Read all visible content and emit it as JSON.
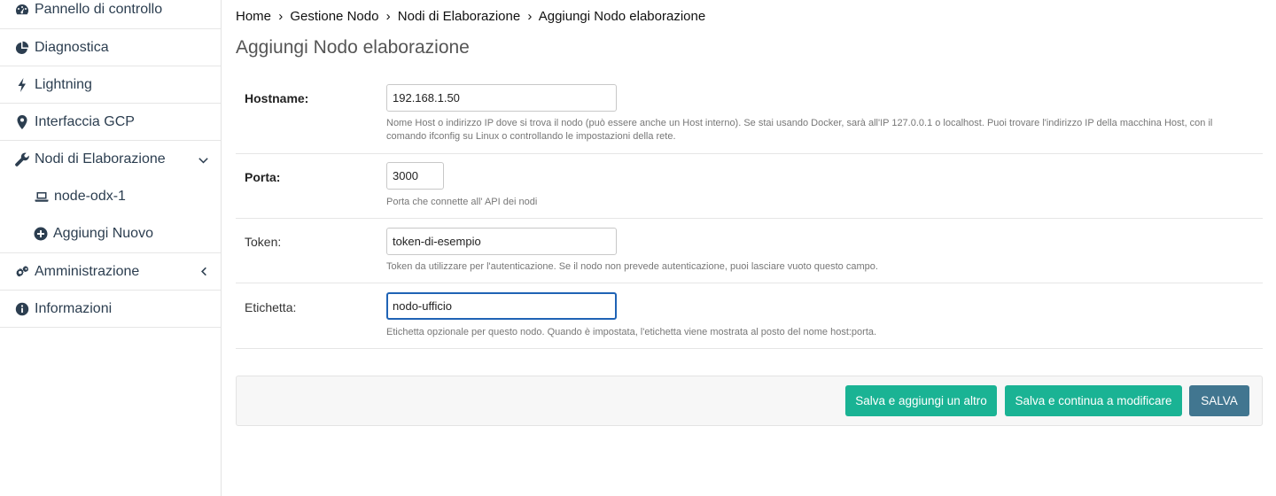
{
  "sidebar": {
    "items": [
      {
        "label": "Pannello di controllo",
        "icon": "dashboard-icon"
      },
      {
        "label": "Diagnostica",
        "icon": "pie-chart-icon"
      },
      {
        "label": "Lightning",
        "icon": "bolt-icon"
      },
      {
        "label": "Interfaccia GCP",
        "icon": "map-marker-icon"
      },
      {
        "label": "Nodi di Elaborazione",
        "icon": "wrench-icon",
        "expanded": true
      },
      {
        "label": "Amministrazione",
        "icon": "gears-icon",
        "expanded": false
      },
      {
        "label": "Informazioni",
        "icon": "info-circle-icon"
      }
    ],
    "subitems": [
      {
        "label": "node-odx-1",
        "icon": "laptop-icon"
      },
      {
        "label": "Aggiungi Nuovo",
        "icon": "plus-circle-icon"
      }
    ]
  },
  "breadcrumb": {
    "home": "Home",
    "sep": "›",
    "level1": "Gestione Nodo",
    "level2": "Nodi di Elaborazione",
    "current": "Aggiungi Nodo elaborazione"
  },
  "page_title": "Aggiungi Nodo elaborazione",
  "form": {
    "hostname": {
      "label": "Hostname:",
      "value": "192.168.1.50",
      "help_line1": "Nome Host o indirizzo IP dove si trova il nodo (può essere anche un Host interno). Se stai usando Docker, sarà all'IP 127.0.0.1 o localhost. Puoi trovare l'indirizzo IP della macchina Host, con il",
      "help_line2": "comando ifconfig su Linux o controllando le impostazioni della rete."
    },
    "port": {
      "label": "Porta:",
      "value": "3000",
      "help": "Porta che connette all' API dei nodi"
    },
    "token": {
      "label": "Token:",
      "value": "token-di-esempio",
      "help": "Token da utilizzare per l'autenticazione. Se il nodo non prevede autenticazione, puoi lasciare vuoto questo campo."
    },
    "label_field": {
      "label": "Etichetta:",
      "value": "nodo-ufficio",
      "help": "Etichetta opzionale per questo nodo. Quando è impostata, l'etichetta viene mostrata al posto del nome host:porta."
    }
  },
  "buttons": {
    "save_add_another": "Salva e aggiungi un altro",
    "save_continue": "Salva e continua a modificare",
    "save": "SALVA"
  },
  "colors": {
    "primary_teal": "#1ab394",
    "save_blue": "#417690",
    "focus_border": "#1f63b5"
  }
}
